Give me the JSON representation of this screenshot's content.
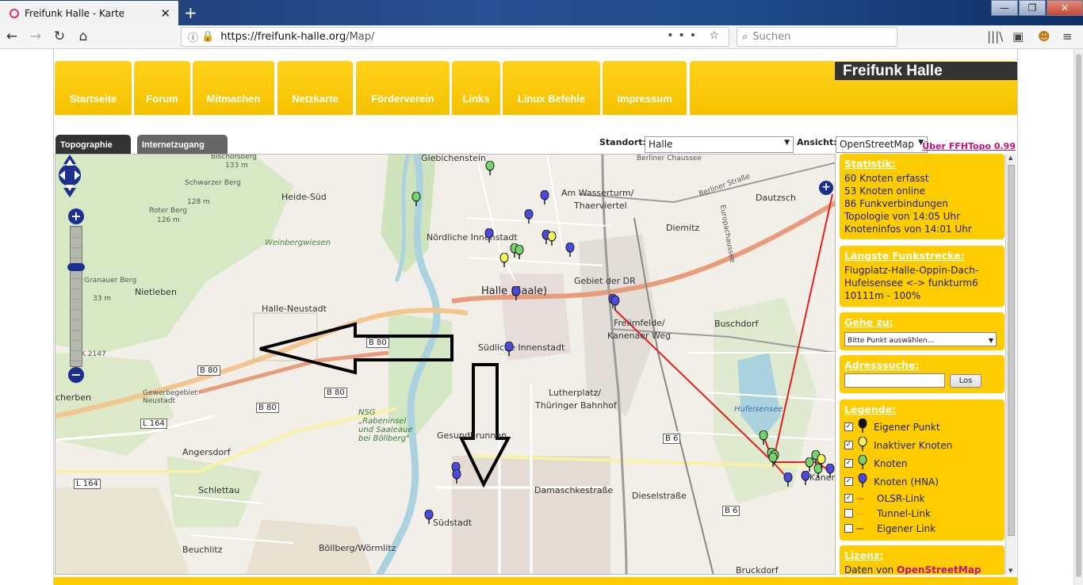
{
  "browser": {
    "tab_title": "Freifunk Halle - Karte",
    "tab_close": "✕",
    "new_tab": "+",
    "url_host": "https://freifunk-halle.org",
    "url_path": "/Map/",
    "url_actions": "••• ☆",
    "search_placeholder": "Suchen",
    "win_min": "—",
    "win_max": "❐",
    "win_close": "✕"
  },
  "site": {
    "brand": "Freifunk Halle",
    "nav": [
      "Startseite",
      "Forum",
      "Mitmachen",
      "Netzkarte",
      "Förderverein",
      "Links",
      "Linux Befehle",
      "Impressum"
    ]
  },
  "map_tabs": {
    "topographie": "Topographie",
    "internetzugang": "Internetzugang"
  },
  "controls": {
    "standort_label": "Standort:",
    "standort_value": "Halle",
    "ansicht_label": "Ansicht:",
    "ansicht_value": "OpenStreetMap",
    "about_link": "Über FFHTopo 0.99"
  },
  "map_labels": {
    "giebichenstein": "Giebichenstein",
    "bischofsberg": "Bischofsberg",
    "bischofsberg_h": "133 m",
    "heide_sued": "Heide-Süd",
    "schwarzer_berg": "Schwarzer Berg",
    "schwarzer_berg_h": "128 m",
    "roter_berg": "Roter Berg",
    "roter_berg_h": "126 m",
    "weinbergwiesen": "Weinbergwiesen",
    "am_wasserturm": "Am Wasserturm/",
    "thaerviertel": "Thaerviertel",
    "dautzsch": "Dautzsch",
    "berliner_chaussee": "Berliner Chaussee",
    "berliner_strasse": "Berliner Straße",
    "europachaussee": "Europachaussee",
    "noerdliche_innenstadt": "Nördliche Innenstadt",
    "diemitz": "Diemitz",
    "granauer_berg": "Granauer Berg",
    "granauer_berg_h": "33 m",
    "nietleben": "Nietleben",
    "halle_saale": "Halle (Saale)",
    "gebiet_der_dr": "Gebiet der DR",
    "halle_neustadt": "Halle-Neustadt",
    "freiimfelde": "Freiimfelde/",
    "kanenaer_weg": "Kanenaer Weg",
    "buschdorf": "Buschdorf",
    "suedliche_innenstadt": "Südliche Innenstadt",
    "k2147": "K 2147",
    "b80_1": "B 80",
    "b80_2": "B 80",
    "b80_3": "B 80",
    "b80_4": "B 80",
    "scherben": "cherben",
    "gewerbegebiet": "Gewerbegebiet Neustadt",
    "lutherplatz": "Lutherplatz/",
    "thueringer_bahnhof": "Thüringer Bahnhof",
    "hufeisensee": "Hufeisensee",
    "nsg": "NSG „Rabeninsel und Saaleaue bei Böllberg\"",
    "l164_1": "L 164",
    "gesundbrunnen": "Gesundbrunnen",
    "b6_1": "B 6",
    "angersdorf": "Angersdorf",
    "l164_2": "L 164",
    "schlettau": "Schlettau",
    "damaschkestrasse": "Damaschkestraße",
    "dieselstrasse": "Dieselstraße",
    "b6_2": "B 6",
    "suedstadt": "Südstadt",
    "beuchlitz": "Beuchlitz",
    "boellberg": "Böllberg/Wörmlitz",
    "bruckdorf": "Bruckdorf",
    "kanena": "Kanena"
  },
  "statistik": {
    "heading": "Statistik:",
    "lines": [
      "60 Knoten erfasst",
      "53 Knoten online",
      "86 Funkverbindungen",
      "Topologie von 14:05 Uhr",
      "Knoteninfos von 14:01 Uhr"
    ]
  },
  "laengste": {
    "heading": "Längste Funkstrecke:",
    "lines": [
      "Flugplatz-Halle-Oppin-Dach-",
      "Hufeisensee <-> funkturm6",
      "10111m - 100%"
    ]
  },
  "gehe_zu": {
    "heading": "Gehe zu:",
    "select_value": "Bitte Punkt auswählen..."
  },
  "adresssuche": {
    "heading": "Adresssuche:",
    "button": "Los"
  },
  "legende": {
    "heading": "Legende:",
    "items": [
      {
        "label": "Eigener Punkt",
        "checked": "✓",
        "pin_color": "#111111"
      },
      {
        "label": "Inaktiver Knoten",
        "checked": "✓",
        "pin_color": "#f4f25a"
      },
      {
        "label": "Knoten",
        "checked": "✓",
        "pin_color": "#77d26a"
      },
      {
        "label": "Knoten (HNA)",
        "checked": "✓",
        "pin_color": "#4747e0"
      }
    ],
    "lines": [
      {
        "label": "OLSR-Link",
        "checked": "✓",
        "dash": "---",
        "color": "#e02020"
      },
      {
        "label": "Tunnel-Link",
        "checked": "",
        "dash": "---",
        "color": "#e0a020"
      },
      {
        "label": "Eigener Link",
        "checked": "",
        "dash": "---",
        "color": "#111111"
      }
    ]
  },
  "lizenz": {
    "heading": "Lizenz:",
    "text": "Daten von",
    "link": "OpenStreetMap"
  },
  "colors": {
    "accent_yellow": "#ffcc00",
    "brand_bg": "#333333",
    "link_pink": "#c0137a",
    "olsr_red": "#e02020"
  }
}
